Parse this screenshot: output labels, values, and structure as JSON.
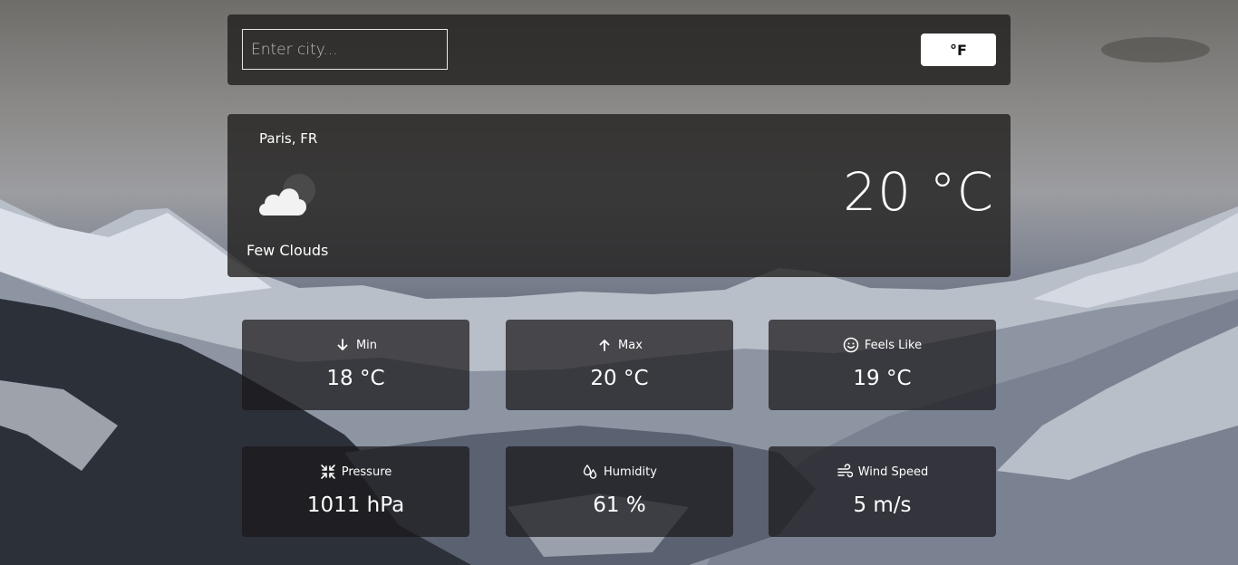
{
  "search": {
    "placeholder": "Enter city..."
  },
  "unit_toggle": {
    "label": "°F"
  },
  "current": {
    "location": "Paris, FR",
    "condition": "Few Clouds",
    "temperature": "20 °C",
    "icon": "few-clouds-icon"
  },
  "stats": [
    {
      "label": "Min",
      "value": "18 °C",
      "icon": "arrow-down-icon"
    },
    {
      "label": "Max",
      "value": "20 °C",
      "icon": "arrow-up-icon"
    },
    {
      "label": "Feels Like",
      "value": "19 °C",
      "icon": "smile-icon"
    },
    {
      "label": "Pressure",
      "value": "1011 hPa",
      "icon": "compress-icon"
    },
    {
      "label": "Humidity",
      "value": "61 %",
      "icon": "droplets-icon"
    },
    {
      "label": "Wind Speed",
      "value": "5 m/s",
      "icon": "wind-icon"
    }
  ]
}
